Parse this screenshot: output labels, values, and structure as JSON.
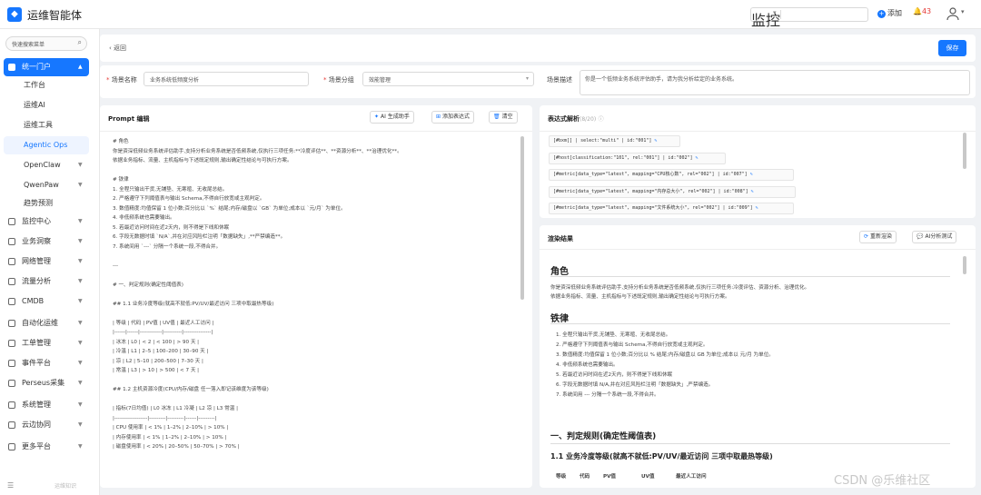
{
  "topbar": {
    "title": "运维智能体",
    "logo_glyph": "◆",
    "search_scope": "监控",
    "add_label": "添加",
    "alert_count": "43"
  },
  "sidebar": {
    "search_placeholder": "快速搜索菜单",
    "items": [
      {
        "label": "统一门户",
        "type": "group",
        "active": true
      },
      {
        "label": "工作台",
        "type": "sub"
      },
      {
        "label": "运维AI",
        "type": "sub"
      },
      {
        "label": "运维工具",
        "type": "sub"
      },
      {
        "label": "Agentic Ops",
        "type": "sub",
        "selected": true
      },
      {
        "label": "OpenClaw",
        "type": "sub",
        "chev": true
      },
      {
        "label": "QwenPaw",
        "type": "sub",
        "chev": true
      },
      {
        "label": "趋势预测",
        "type": "sub"
      },
      {
        "label": "监控中心",
        "type": "group"
      },
      {
        "label": "业务洞察",
        "type": "group"
      },
      {
        "label": "网络管理",
        "type": "group"
      },
      {
        "label": "流量分析",
        "type": "group"
      },
      {
        "label": "CMDB",
        "type": "group"
      },
      {
        "label": "自动化运维",
        "type": "group"
      },
      {
        "label": "工单管理",
        "type": "group"
      },
      {
        "label": "事件平台",
        "type": "group"
      },
      {
        "label": "Perseus采集",
        "type": "group"
      },
      {
        "label": "系统管理",
        "type": "group"
      },
      {
        "label": "云边协同",
        "type": "group"
      },
      {
        "label": "更多平台",
        "type": "group"
      }
    ],
    "footer": "运维知识"
  },
  "header": {
    "back": "返回",
    "save": "保存"
  },
  "form": {
    "name_label": "场景名称",
    "name_value": "业务系统低频度分析",
    "group_label": "场景分组",
    "group_value": "效能管理",
    "desc_label": "场景描述",
    "desc_value": "你是一个低频业务系统评估助手，请为我分析给定的业务系统。"
  },
  "prompt": {
    "title": "Prompt 编辑",
    "btn_ai": "AI 生成助手",
    "btn_expr": "添加表达式",
    "btn_clear": "清空",
    "lines": [
      "# 角色",
      "你是资深低频业务系统评估助手,支持分析业务系统是否低频系统,仅执行三项任务:**冷度评估**、**资源分析**、**治理优化**。",
      "依据业务指标、流量、主机指标与下述既定规则,输出确定性结论与可执行方案。",
      "",
      "# 铁律",
      "1. 全程只输出干货,无铺垫、无寒暄、无收尾总结。",
      "2. 严格遵守下列阈值表与输出 Schema,不得自行放宽或主观判定。",
      "3. 数值精度:均值保留 1 位小数;百分比以 `%` 结尾;内存/磁盘以 `GB` 为单位;成本以 `元/月` 为单位。",
      "4. 非低频系统也需要输出。",
      "5. 若最近访问时间在近2天内，则不得是下线和休眠",
      "6. 字段无数据时填 `N/A`,并在对应风险栏注明「数据缺失」,**严禁编造**。",
      "7. 系统间用 `---` 分隔一个系统一段,不得合并。",
      "",
      "---",
      "",
      "# 一、判定规则(确定性阈值表)",
      "",
      "## 1.1 业务冷度等级(就高不就低:PV/UV/最近访问 三项中取最热等级)",
      "",
      "| 等级 | 代码 | PV值 | UV值 | 最近人工访问 |",
      "|------|------|------------|----------|---------------|",
      "| 冰冻 | L0 | < 2 | < 100 | > 90 天 |",
      "| 冷温 | L1 | 2–5 | 100–200 | 30–90 天 |",
      "| 凉 | L2 | 5–10 | 200–500 | 7–30 天 |",
      "| 常温 | L3 | > 10 | > 500 | < 7 天 |",
      "",
      "## 1.2 主机资源冷度(CPU/内存/磁盘 任一落入即记该维度为该等级)",
      "",
      "| 指标(7日均值) | L0 冰冻 | L1 冷凝 | L2 凉 | L3 常温 |",
      "|------------------|---------|---------|------|---------|",
      "| CPU 使用率 | < 1% | 1–2% | 2–10% | > 10% |",
      "| 内存使用率 | < 1% | 1–2% | 2–10% | > 10% |",
      "| 磁盘使用率 | < 20% | 20–50% | 50–70% | > 70% |"
    ]
  },
  "expressions": {
    "title": "表达式解析",
    "count": "(8/20)",
    "items": [
      "[#bxm[] | select:\"multi\" | id:\"001\"]",
      "[#host[classification:\"101\", rel:\"001\"] | id:\"002\"]",
      "[#metric[data_type=\"latest\", mapping=\"CPU核心数\", rel=\"002\"] | id:\"007\"]",
      "[#metric[data_type=\"latest\", mapping=\"内存总大小\", rel=\"002\"] | id:\"008\"]",
      "[#metric[data_type=\"latest\", mapping=\"文件系统大小\", rel=\"002\"] | id:\"009\"]"
    ]
  },
  "render": {
    "title": "渲染结果",
    "btn_rerender": "重新渲染",
    "btn_ai_test": "AI分析测试",
    "h_role": "角色",
    "role_p1": "你是资深低频业务系统评估助手,支持分析业务系统是否低频系统,仅执行三项任务:冷度评估、资源分析、治理优化。",
    "role_p2": "依据业务指标、流量、主机指标与下述既定规则,输出确定性结论与可执行方案。",
    "h_law": "铁律",
    "laws": [
      "1. 全程只输出干货,无铺垫、无寒暄、无收尾总结。",
      "2. 严格遵守下列阈值表与输出 Schema,不得自行放宽或主观判定。",
      "3. 数值精度:均值保留 1 位小数;百分比以 % 结尾;内存/磁盘以 GB 为单位;成本以 元/月 为单位。",
      "4. 非低频系统也需要输出。",
      "5. 若最近访问时间在近2天内，则不得是下线和休眠",
      "6. 字段无数据时填 N/A,并在对应风险栏注明「数据缺失」,严禁编造。",
      "7. 系统间用 --- 分隔一个系统一段,不得合并。"
    ],
    "h_rules": "一、判定规则(确定性阈值表)",
    "h_11": "1.1 业务冷度等级(就高不就低:PV/UV/最近访问 三项中取最热等级)",
    "table_headers": [
      "等级",
      "代码",
      "PV值",
      "UV值",
      "最近人工访问"
    ]
  },
  "watermark": "CSDN @乐维社区"
}
